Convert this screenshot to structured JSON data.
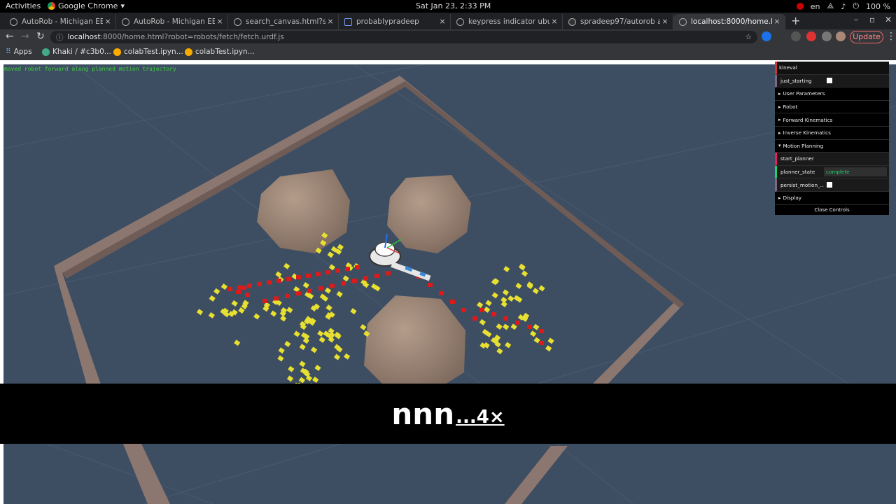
{
  "system_bar": {
    "activities": "Activities",
    "app_name": "Google Chrome",
    "clock": "Sat Jan 23,  2:33 PM",
    "language": "en",
    "battery": "100 %"
  },
  "tabs": [
    {
      "label": "AutoRob - Michigan EECS",
      "active": false
    },
    {
      "label": "AutoRob - Michigan EECS",
      "active": false
    },
    {
      "label": "search_canvas.html?sear",
      "active": false
    },
    {
      "label": "probablypradeep",
      "active": false
    },
    {
      "label": "keypress indicator ubunt",
      "active": false
    },
    {
      "label": "spradeep97/autorob at p",
      "active": false
    },
    {
      "label": "localhost:8000/home.htm",
      "active": true
    }
  ],
  "address_bar": {
    "host": "localhost",
    "path": ":8000/home.html?robot=robots/fetch/fetch.urdf.js"
  },
  "update_button": "Update",
  "bookmarks": [
    {
      "label": "Apps",
      "icon": "apps-grid-icon"
    },
    {
      "label": "Khaki / #c3b0...",
      "icon": "colorhexa-icon"
    },
    {
      "label": "colabTest.ipyn...",
      "icon": "colab-icon"
    },
    {
      "label": "colabTest.ipyn...",
      "icon": "colab-icon"
    }
  ],
  "status_message": "moved robot forward along planned motion trajectory",
  "controls": {
    "title": "kineval",
    "just_starting_label": "just_starting",
    "folders": {
      "user_parameters": "User Parameters",
      "robot": "Robot",
      "forward_kinematics": "Forward Kinematics",
      "inverse_kinematics": "Inverse Kinematics",
      "motion_planning": "Motion Planning",
      "display": "Display"
    },
    "start_planner": "start_planner",
    "planner_state_label": "planner_state",
    "planner_state_value": "complete",
    "persist_motion_label": "persist_motion_...",
    "close_controls": "Close Controls"
  },
  "caption": {
    "keys": "nnn",
    "repeat": "...4×"
  },
  "colors": {
    "scene_background": "#3e4e62",
    "wall": "#8a7670",
    "obstacle": "#a08878",
    "tree_node_yellow": "#e8e030",
    "path_node_red": "#dd1a1a",
    "status_green": "#3cd23c"
  }
}
